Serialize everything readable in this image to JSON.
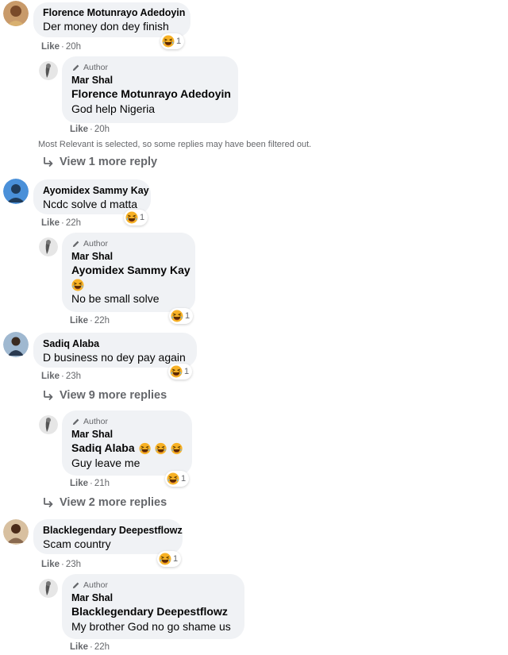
{
  "reaction_emoji": "laughing-emoji",
  "threads": [
    {
      "author": "Florence Motunrayo Adedoyin",
      "text": "Der money don dey finish",
      "like": "Like",
      "time": "20h",
      "reactions": "1",
      "reply": {
        "author_tag": "Author",
        "name": "Mar Shal",
        "mention": "Florence Motunrayo Adedoyin",
        "text": "God help Nigeria",
        "like": "Like",
        "time": "20h"
      },
      "filter_note": "Most Relevant is selected, so some replies may have been filtered out.",
      "view_more": "View 1 more reply"
    },
    {
      "author": "Ayomidex Sammy Kay",
      "text": "Ncdc solve d matta",
      "like": "Like",
      "time": "22h",
      "reactions": "1",
      "reply": {
        "author_tag": "Author",
        "name": "Mar Shal",
        "mention": "Ayomidex Sammy Kay",
        "text": "No be small solve",
        "like": "Like",
        "time": "22h",
        "reactions": "1"
      }
    },
    {
      "author": "Sadiq Alaba",
      "text": "D business no dey pay again",
      "like": "Like",
      "time": "23h",
      "reactions": "1",
      "view_more": "View 9 more replies",
      "reply": {
        "author_tag": "Author",
        "name": "Mar Shal",
        "mention": "Sadiq Alaba",
        "text": "Guy leave me",
        "like": "Like",
        "time": "21h",
        "reactions": "1"
      },
      "view_more_2": "View 2 more replies"
    },
    {
      "author": "Blacklegendary Deepestflowz",
      "text": "Scam country",
      "like": "Like",
      "time": "23h",
      "reactions": "1",
      "reply": {
        "author_tag": "Author",
        "name": "Mar Shal",
        "mention": "Blacklegendary Deepestflowz",
        "text": "My brother God no go shame us",
        "like": "Like",
        "time": "22h"
      }
    }
  ],
  "colors": {
    "bubble": "#f0f2f5",
    "meta": "#65676b",
    "text": "#050505"
  }
}
